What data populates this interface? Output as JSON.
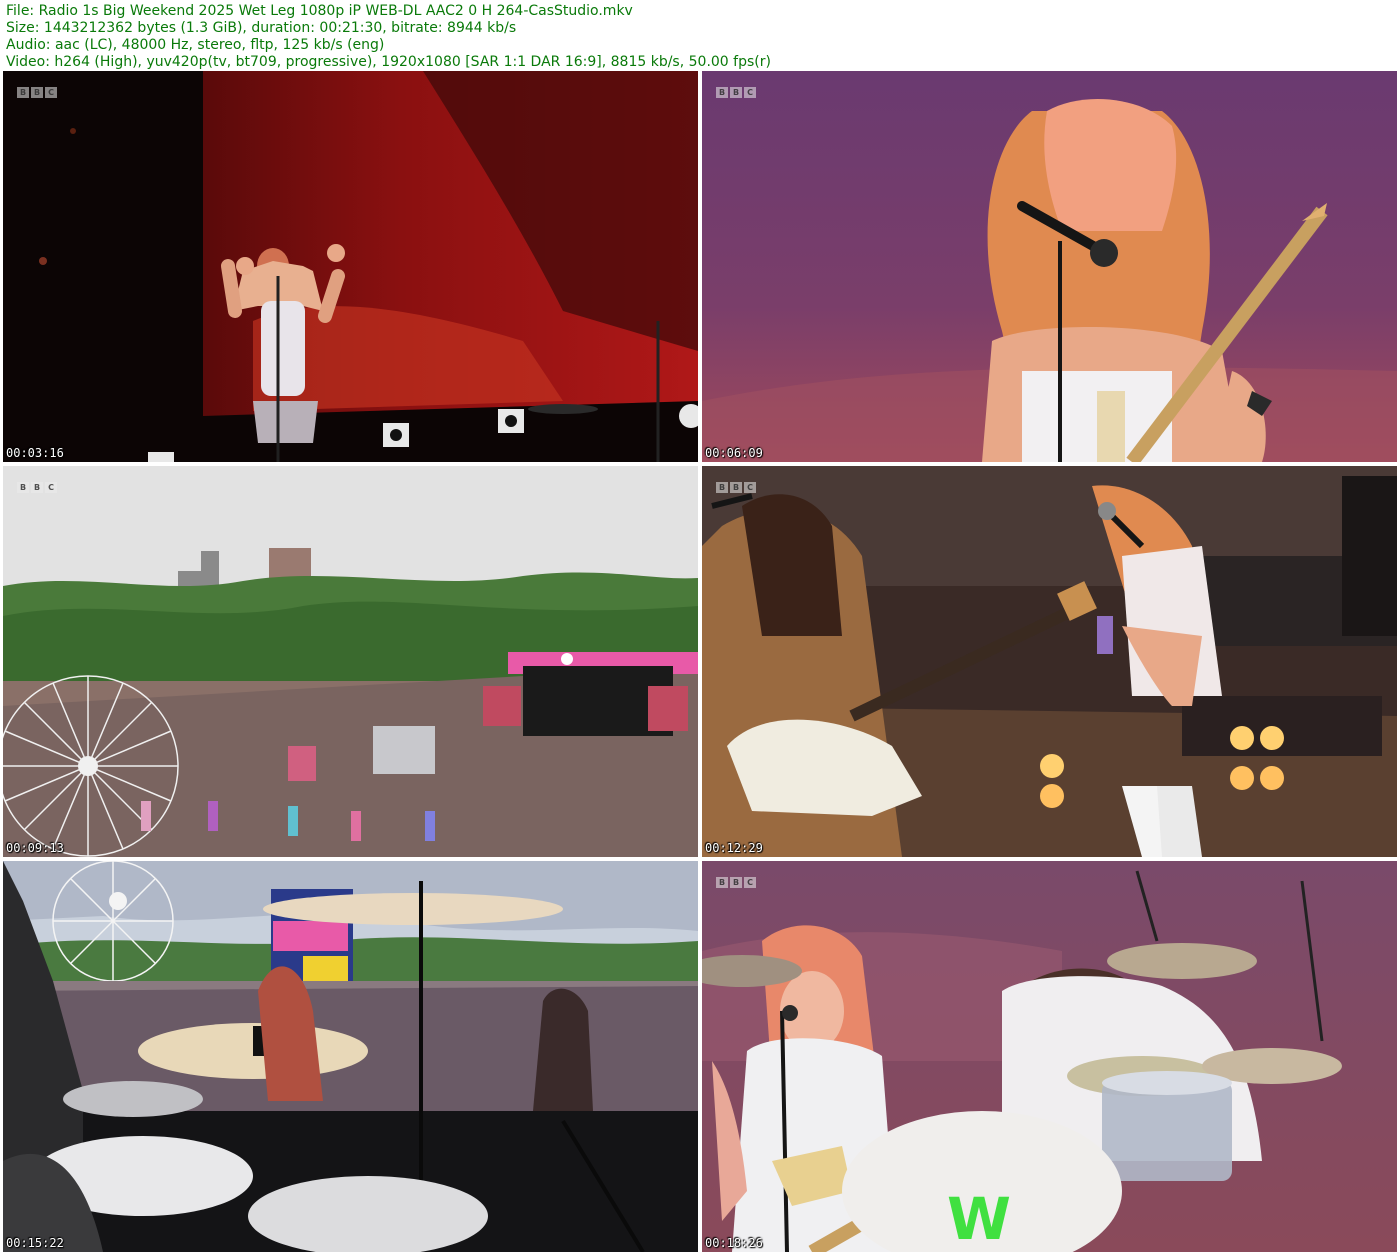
{
  "header": {
    "file_line": "File: Radio 1s Big Weekend 2025 Wet Leg 1080p iP WEB-DL AAC2 0 H 264-CasStudio.mkv",
    "size_line": "Size: 1443212362 bytes (1.3 GiB), duration: 00:21:30, bitrate: 8944 kb/s",
    "audio_line": "Audio: aac (LC), 48000 Hz, stereo, fltp, 125 kb/s (eng)",
    "video_line": "Video: h264 (High), yuv420p(tv, bt709, progressive), 1920x1080 [SAR 1:1 DAR 16:9], 8815 kb/s, 50.00 fps(r)"
  },
  "watermark": {
    "letters": [
      "B",
      "B",
      "C"
    ]
  },
  "thumbnails": [
    {
      "timestamp": "00:03:16",
      "scene": "singer-flexing-in-front-of-red-screen"
    },
    {
      "timestamp": "00:06:09",
      "scene": "singer-with-guitar-closeup"
    },
    {
      "timestamp": "00:09:13",
      "scene": "aerial-festival-crowd-with-ferris-wheel"
    },
    {
      "timestamp": "00:12:29",
      "scene": "guitarists-on-stage"
    },
    {
      "timestamp": "00:15:22",
      "scene": "view-from-behind-drum-kit"
    },
    {
      "timestamp": "00:18:26",
      "scene": "singer-and-drummer"
    }
  ],
  "colors": {
    "header_text": "#0a7a0a",
    "background": "#ffffff"
  }
}
